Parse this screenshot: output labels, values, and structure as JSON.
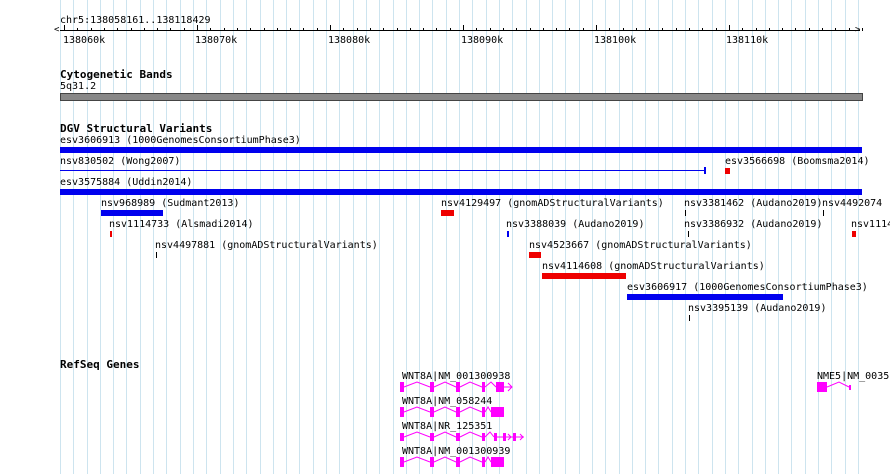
{
  "region": "chr5:138058161..138118429",
  "ruler": {
    "tick_labels": [
      "138060k",
      "138070k",
      "138080k",
      "138090k",
      "138100k",
      "138110k"
    ]
  },
  "tracks": {
    "cytoband": {
      "title": "Cytogenetic Bands",
      "band_label": "5q31.2"
    },
    "dgv": {
      "title": "DGV Structural Variants",
      "features": [
        {
          "label": "esv3606913 (1000GenomesConsortiumPhase3)",
          "color": "#0000ee"
        },
        {
          "label": "nsv830502 (Wong2007)",
          "color": "#0000ee"
        },
        {
          "label": "esv3566698 (Boomsma2014)",
          "color": "#ee0000"
        },
        {
          "label": "esv3575884 (Uddin2014)",
          "color": "#0000ee"
        },
        {
          "label": "nsv968989 (Sudmant2013)",
          "color": "#0000ee"
        },
        {
          "label": "nsv4129497 (gnomADStructuralVariants)",
          "color": "#ee0000"
        },
        {
          "label": "nsv3381462 (Audano2019)",
          "color": "#000000"
        },
        {
          "label": "nsv4492074",
          "color": "#000000"
        },
        {
          "label": "nsv1114733 (Alsmadi2014)",
          "color": "#ee0000"
        },
        {
          "label": "nsv3388039 (Audano2019)",
          "color": "#0000ee"
        },
        {
          "label": "nsv3386932 (Audano2019)",
          "color": "#000000"
        },
        {
          "label": "nsv1114",
          "color": "#ee0000"
        },
        {
          "label": "nsv4497881 (gnomADStructuralVariants)",
          "color": "#000000"
        },
        {
          "label": "nsv4523667 (gnomADStructuralVariants)",
          "color": "#ee0000"
        },
        {
          "label": "nsv4114608 (gnomADStructuralVariants)",
          "color": "#ee0000"
        },
        {
          "label": "esv3606917 (1000GenomesConsortiumPhase3)",
          "color": "#0000ee"
        },
        {
          "label": "nsv3395139 (Audano2019)",
          "color": "#000000"
        }
      ]
    },
    "refseq": {
      "title": "RefSeq Genes",
      "gene_color": "#ff00ff",
      "genes": [
        {
          "label": "WNT8A|NM_001300938"
        },
        {
          "label": "NME5|NM_0035"
        },
        {
          "label": "WNT8A|NM_058244"
        },
        {
          "label": "WNT8A|NR_125351"
        },
        {
          "label": "WNT8A|NM_001300939"
        }
      ]
    }
  },
  "colors": {
    "grid": "#cde4ef",
    "cytoband_fill": "#888888",
    "cytoband_border": "#444444"
  }
}
